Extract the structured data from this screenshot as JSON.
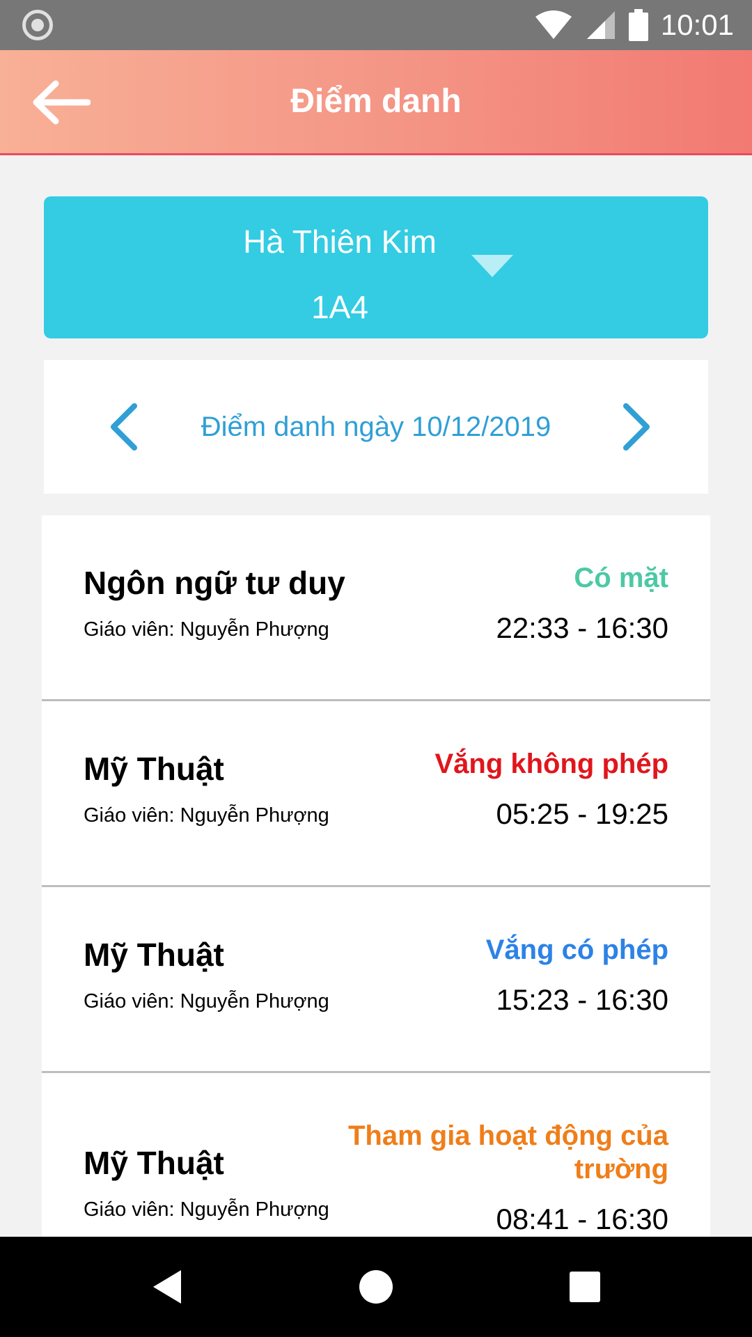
{
  "status_bar": {
    "time": "10:01",
    "icons": [
      "record-icon",
      "wifi-icon",
      "signal-icon",
      "battery-icon"
    ]
  },
  "app_bar": {
    "title": "Điểm danh",
    "back_icon": "arrow-left-icon"
  },
  "student": {
    "name": "Hà Thiên Kim",
    "class": "1A4",
    "dropdown_icon": "caret-down-icon"
  },
  "date_nav": {
    "label": "Điểm danh ngày 10/12/2019",
    "prev_icon": "chevron-left-icon",
    "next_icon": "chevron-right-icon"
  },
  "attendance": [
    {
      "subject": "Ngôn ngữ tư duy",
      "teacher": "Giáo viên: Nguyễn Phượng",
      "status": "Có mặt",
      "status_color": "#4cc9a4",
      "time": "22:33 - 16:30"
    },
    {
      "subject": "Mỹ Thuật",
      "teacher": "Giáo viên: Nguyễn Phượng",
      "status": "Vắng không phép",
      "status_color": "#e0161c",
      "time": "05:25 - 19:25"
    },
    {
      "subject": "Mỹ Thuật",
      "teacher": "Giáo viên: Nguyễn Phượng",
      "status": "Vắng có phép",
      "status_color": "#2c82e6",
      "time": "15:23 - 16:30"
    },
    {
      "subject": "Mỹ Thuật",
      "teacher": "Giáo viên: Nguyễn Phượng",
      "status": "Tham gia hoạt động của trường",
      "status_color": "#ef7e1a",
      "time": "08:41 - 16:30"
    }
  ],
  "nav_bar": {
    "icons": [
      "nav-back-icon",
      "nav-home-icon",
      "nav-recents-icon"
    ]
  },
  "colors": {
    "accent": "#33cce3",
    "header_start": "#f8b096",
    "header_end": "#f27a72",
    "date_text": "#2f9fd6"
  }
}
